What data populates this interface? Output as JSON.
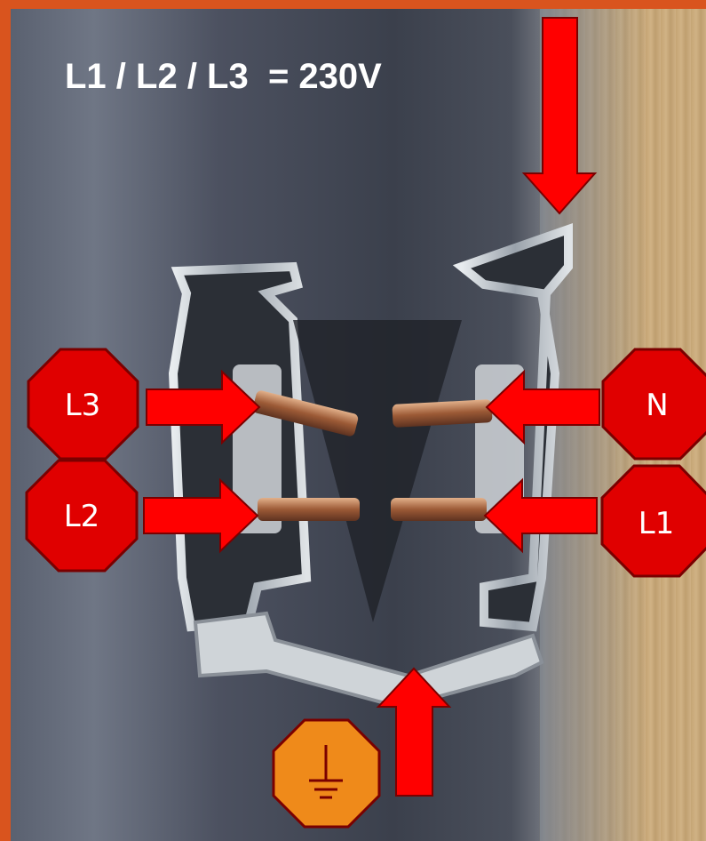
{
  "title": "L1 / L2 / L3  = 230V",
  "colors": {
    "frame": "#d9541e",
    "arrow": "#ff0000",
    "octagon_fill": "#e00000",
    "octagon_stroke": "#7a0000",
    "ground_fill": "#ef8a1a"
  },
  "labels": {
    "l3": "L3",
    "l2": "L2",
    "n": "N",
    "l1": "L1"
  },
  "icons": {
    "ground": "ground-icon"
  }
}
